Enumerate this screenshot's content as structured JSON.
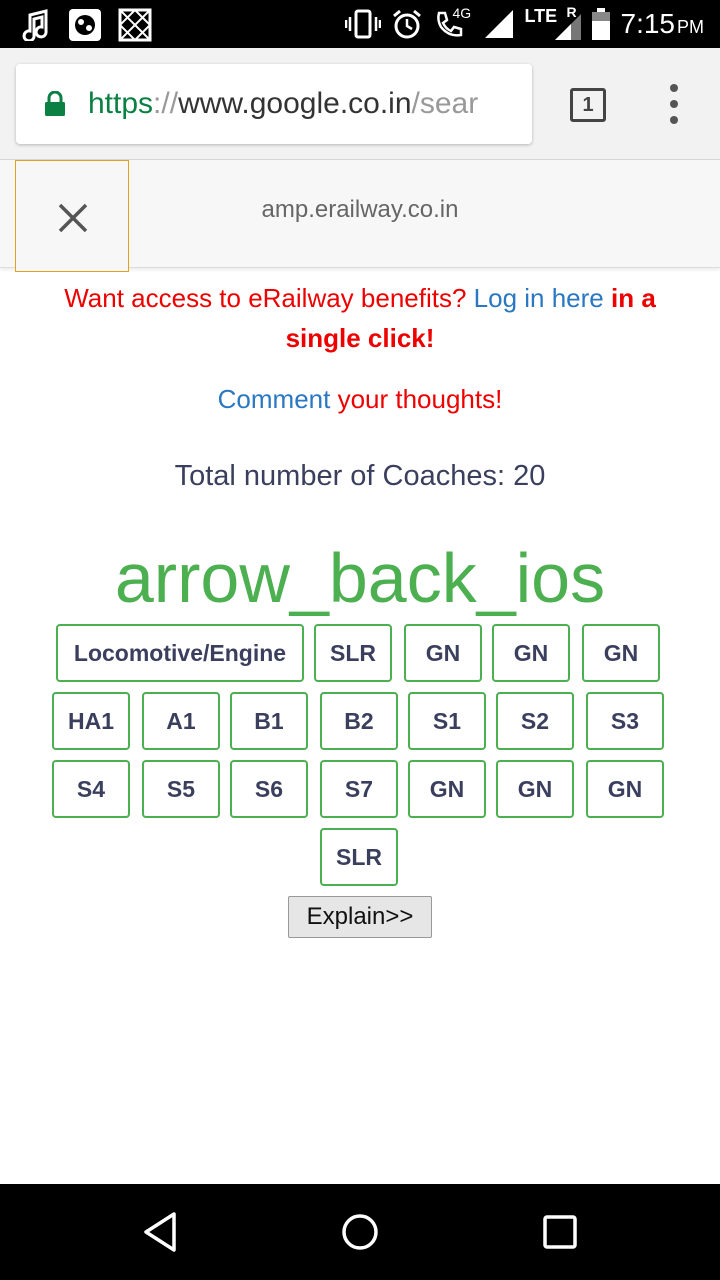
{
  "status_bar": {
    "time": "7:15",
    "ampm": "PM",
    "network": "LTE",
    "network_sub": "4G",
    "roaming": "R",
    "icons": [
      "music-note-icon",
      "game-app-icon",
      "gallery-app-icon",
      "vibrate-icon",
      "alarm-icon",
      "wifi-call-icon",
      "signal-icon",
      "battery-icon"
    ]
  },
  "browser": {
    "url_scheme": "https",
    "url_sep": "://",
    "url_host": "www.google.co.in",
    "url_path": "/sear",
    "tab_count": "1"
  },
  "amp_header": {
    "domain": "amp.erailway.co.in"
  },
  "promo": {
    "prefix": "Want access to eRailway benefits? ",
    "link": "Log in here",
    "suffix_bold": " in a single click!"
  },
  "comment": {
    "link": "Comment",
    "rest": " your thoughts!"
  },
  "total_coaches": "Total number of Coaches: 20",
  "arrow_text": "arrow_back_ios",
  "coaches": {
    "row1": [
      "Locomotive/Engine",
      "SLR",
      "GN",
      "GN",
      "GN"
    ],
    "row2": [
      "HA1",
      "A1",
      "B1",
      "B2",
      "S1",
      "S2",
      "S3"
    ],
    "row3": [
      "S4",
      "S5",
      "S6",
      "S7",
      "GN",
      "GN",
      "GN"
    ],
    "row4": [
      "SLR"
    ]
  },
  "explain_label": "Explain>>",
  "colors": {
    "accent_green": "#4caf50",
    "link_blue": "#2a78c2",
    "promo_red": "#e00000",
    "text_dark": "#3b3f5e"
  }
}
